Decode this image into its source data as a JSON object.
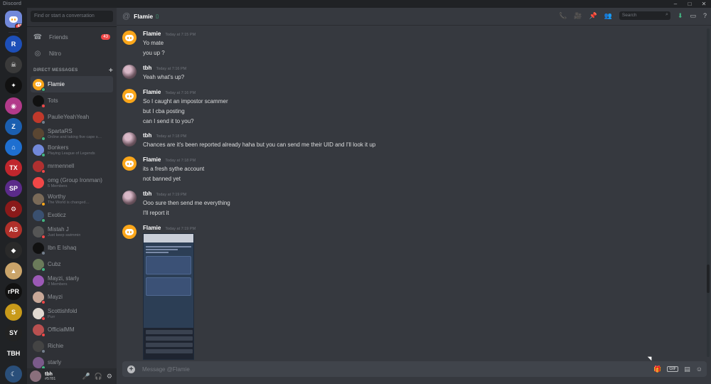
{
  "app": {
    "title": "Discord",
    "window_controls": [
      "–",
      "□",
      "✕"
    ]
  },
  "servers": [
    {
      "label": "",
      "color": "#7289da",
      "badge": "43",
      "kind": "home"
    },
    {
      "label": "R",
      "color": "#1d4fb8"
    },
    {
      "label": "☠",
      "color": "#3a3a3a"
    },
    {
      "label": "✦",
      "color": "#111111"
    },
    {
      "label": "◉",
      "color": "#b23a8a"
    },
    {
      "label": "Z",
      "color": "#1b5fb0"
    },
    {
      "label": "⌂",
      "color": "#1e6fd0"
    },
    {
      "label": "TX",
      "color": "#c0262d"
    },
    {
      "label": "SP",
      "color": "#5b2b8a"
    },
    {
      "label": "⚙",
      "color": "#8a1a1a"
    },
    {
      "label": "AS",
      "color": "#b0302a"
    },
    {
      "label": "◆",
      "color": "#2a2a2a"
    },
    {
      "label": "▲",
      "color": "#caa46a"
    },
    {
      "label": "rPR",
      "color": "#111111"
    },
    {
      "label": "S",
      "color": "#c89a1a"
    },
    {
      "label": "SY",
      "color": "#222222"
    },
    {
      "label": "TBH",
      "color": "#202225"
    },
    {
      "label": "☾",
      "color": "#2a4f7a"
    }
  ],
  "sidebar": {
    "search_placeholder": "Find or start a conversation",
    "nav": [
      {
        "label": "Friends",
        "icon": "friends-icon",
        "glyph": "☎",
        "badge": "43"
      },
      {
        "label": "Nitro",
        "icon": "nitro-icon",
        "glyph": "◎"
      }
    ],
    "dm_header": "DIRECT MESSAGES",
    "dm_add": "+",
    "dms": [
      {
        "name": "Flamie",
        "sub": "",
        "color": "#faa61a",
        "status": "#43b581",
        "active": true
      },
      {
        "name": "Tots",
        "sub": "",
        "color": "#111111",
        "status": "#f04747"
      },
      {
        "name": "PaulieYeahYeah",
        "sub": "",
        "color": "#c0392b",
        "status": "#747f8d"
      },
      {
        "name": "SpartaRS",
        "sub": "Online and taking five cape s…",
        "color": "#5a4632",
        "status": "#43b581"
      },
      {
        "name": "Bonkers",
        "sub": "Playing League of Legends",
        "color": "#7289da",
        "status": "#43b581"
      },
      {
        "name": "mrmennell",
        "sub": "",
        "color": "#b03030",
        "status": "#f04747"
      },
      {
        "name": "omg (Group Ironman)",
        "sub": "5 Members",
        "color": "#f04747",
        "status": ""
      },
      {
        "name": "Worthy",
        "sub": "The World is changed…",
        "color": "#7a6a58",
        "status": "#faa61a"
      },
      {
        "name": "Exoticz",
        "sub": "",
        "color": "#3a5070",
        "status": "#43b581"
      },
      {
        "name": "Mistah J",
        "sub": "Just keep swimmin",
        "color": "#555555",
        "status": "#f04747"
      },
      {
        "name": "Ibn E Ishaq",
        "sub": "",
        "color": "#111111",
        "status": "#747f8d"
      },
      {
        "name": "Cubz",
        "sub": "",
        "color": "#6a7a5a",
        "status": "#43b581"
      },
      {
        "name": "Mayzi, starly",
        "sub": "3 Members",
        "color": "#9b59b6",
        "status": ""
      },
      {
        "name": "Mayzi",
        "sub": "",
        "color": "#c8a898",
        "status": "#f04747"
      },
      {
        "name": "Scottishfold",
        "sub": "Purr",
        "color": "#e0d8d0",
        "status": "#f04747"
      },
      {
        "name": "OfficialMM",
        "sub": "",
        "color": "#b85050",
        "status": "#f04747"
      },
      {
        "name": "Richie",
        "sub": "",
        "color": "#444444",
        "status": "#747f8d"
      },
      {
        "name": "starly",
        "sub": "",
        "color": "#7a5a8a",
        "status": "#43b581"
      }
    ]
  },
  "user": {
    "name": "tbh",
    "tag": "#5781",
    "controls": [
      "🎤",
      "🎧",
      "⚙"
    ]
  },
  "chat": {
    "at_symbol": "@",
    "recipient": "Flamie",
    "mobile_glyph": "▯",
    "header_tools": [
      "📞",
      "🎥",
      "📌",
      "👥"
    ],
    "search_placeholder": "Search",
    "extra_tools": [
      "⬇",
      "▭",
      "?"
    ],
    "messages": [
      {
        "author": "Flamie",
        "time": "Today at 7:15 PM",
        "avatar": "discord-orange",
        "lines": [
          "Yo mate",
          "you up ?"
        ]
      },
      {
        "author": "tbh",
        "time": "Today at 7:16 PM",
        "avatar": "user",
        "lines": [
          "Yeah what's up?"
        ]
      },
      {
        "author": "Flamie",
        "time": "Today at 7:16 PM",
        "avatar": "discord-orange",
        "lines": [
          "So I caught an impostor scammer",
          "but I cba posting",
          "can I send it to you?"
        ]
      },
      {
        "author": "tbh",
        "time": "Today at 7:18 PM",
        "avatar": "user",
        "lines": [
          "Chances are it's been reported already haha but you can send me their UID and I'll look it up"
        ]
      },
      {
        "author": "Flamie",
        "time": "Today at 7:18 PM",
        "avatar": "discord-orange",
        "lines": [
          "its a fresh sythe account",
          "not banned yet"
        ]
      },
      {
        "author": "tbh",
        "time": "Today at 7:19 PM",
        "avatar": "user",
        "lines": [
          "Ooo sure then send me everything",
          "I'll report it"
        ]
      },
      {
        "author": "Flamie",
        "time": "Today at 7:19 PM",
        "avatar": "discord-orange",
        "lines": []
      }
    ],
    "composer_placeholder": "Message @Flamie",
    "composer_plus": "+",
    "composer_tools": [
      "🎁",
      "GIF",
      "▤",
      "☺"
    ]
  }
}
